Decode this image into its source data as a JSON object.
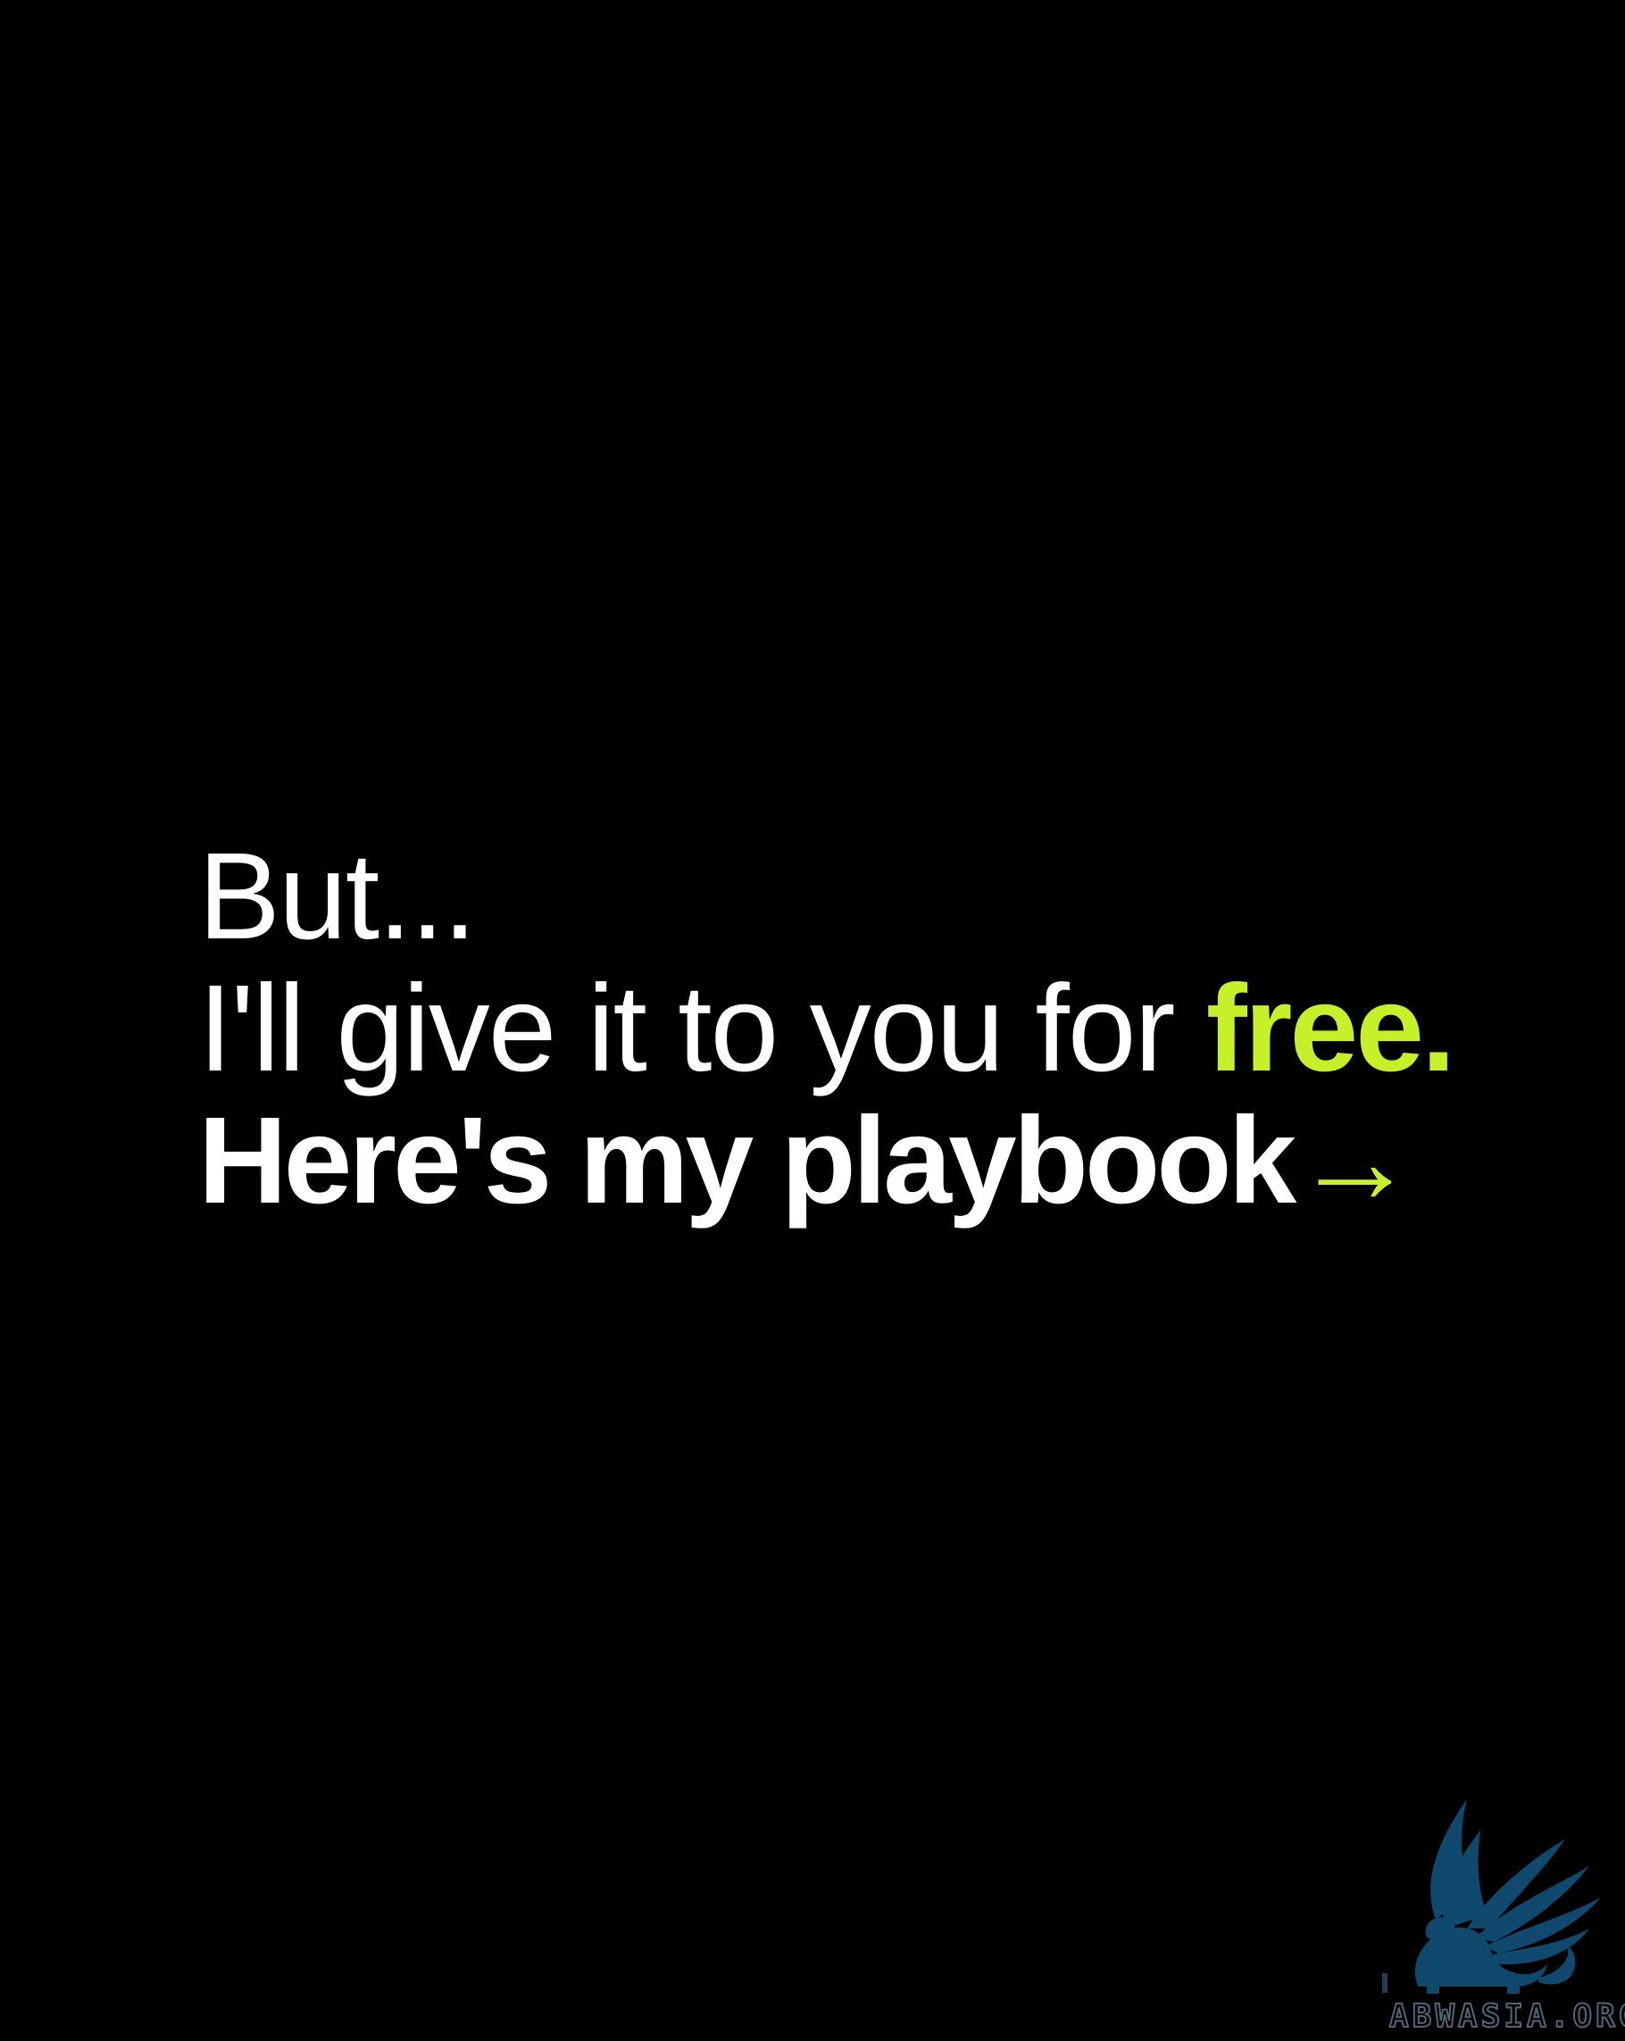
{
  "message": {
    "line1": "But...",
    "line2_prefix": "I'll give it to you for ",
    "line2_highlight": "free.",
    "line3_text": "Here's my playbook",
    "line3_arrow": "→"
  },
  "watermark": {
    "icon": "griffin-logo-icon",
    "text": "ABWASIA.ORG"
  },
  "colors": {
    "background": "#000000",
    "text": "#ffffff",
    "accent": "#c6f12a",
    "logo": "#0f4a6e"
  }
}
